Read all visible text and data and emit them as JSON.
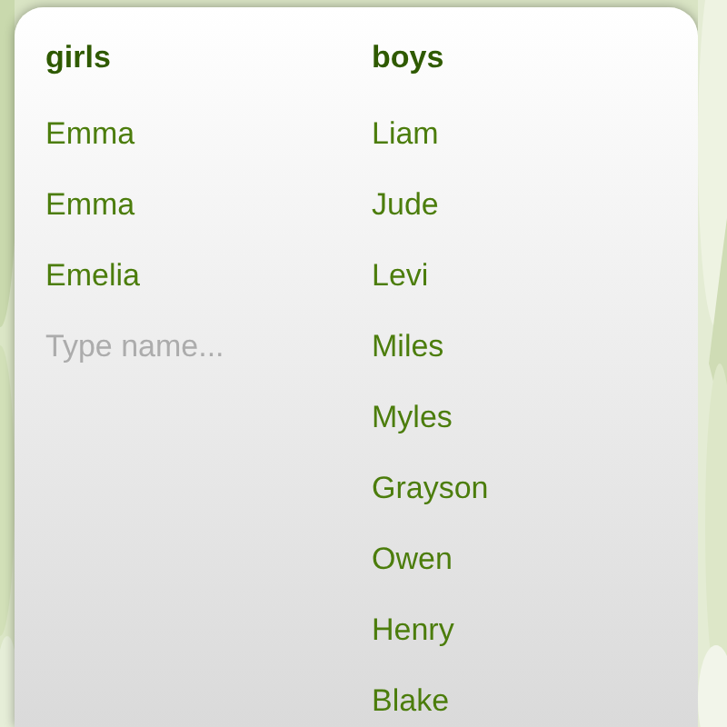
{
  "columns": [
    {
      "heading": "girls",
      "names": [
        "Emma",
        "Emma",
        "Emelia"
      ],
      "input": {
        "placeholder": "Type name..."
      }
    },
    {
      "heading": "boys",
      "names": [
        "Liam",
        "Jude",
        "Levi",
        "Miles",
        "Myles",
        "Grayson",
        "Owen",
        "Henry",
        "Blake"
      ]
    }
  ]
}
